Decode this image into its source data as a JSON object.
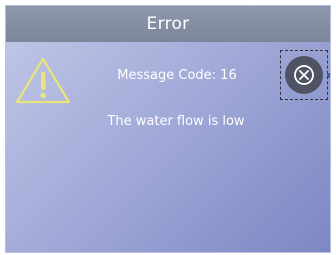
{
  "dialog": {
    "title": "Error",
    "message_code_text": "Message Code: 16",
    "message_text": "The water flow is low",
    "icons": {
      "warning": "warning-triangle-icon",
      "close": "close-circle-icon"
    },
    "colors": {
      "titlebar": "#848ca0",
      "background_light": "#c3c9e8",
      "background_dark": "#7d87c3",
      "warning_stroke": "#e8e57a",
      "close_button": "#4f5464",
      "text": "#ffffff"
    }
  }
}
